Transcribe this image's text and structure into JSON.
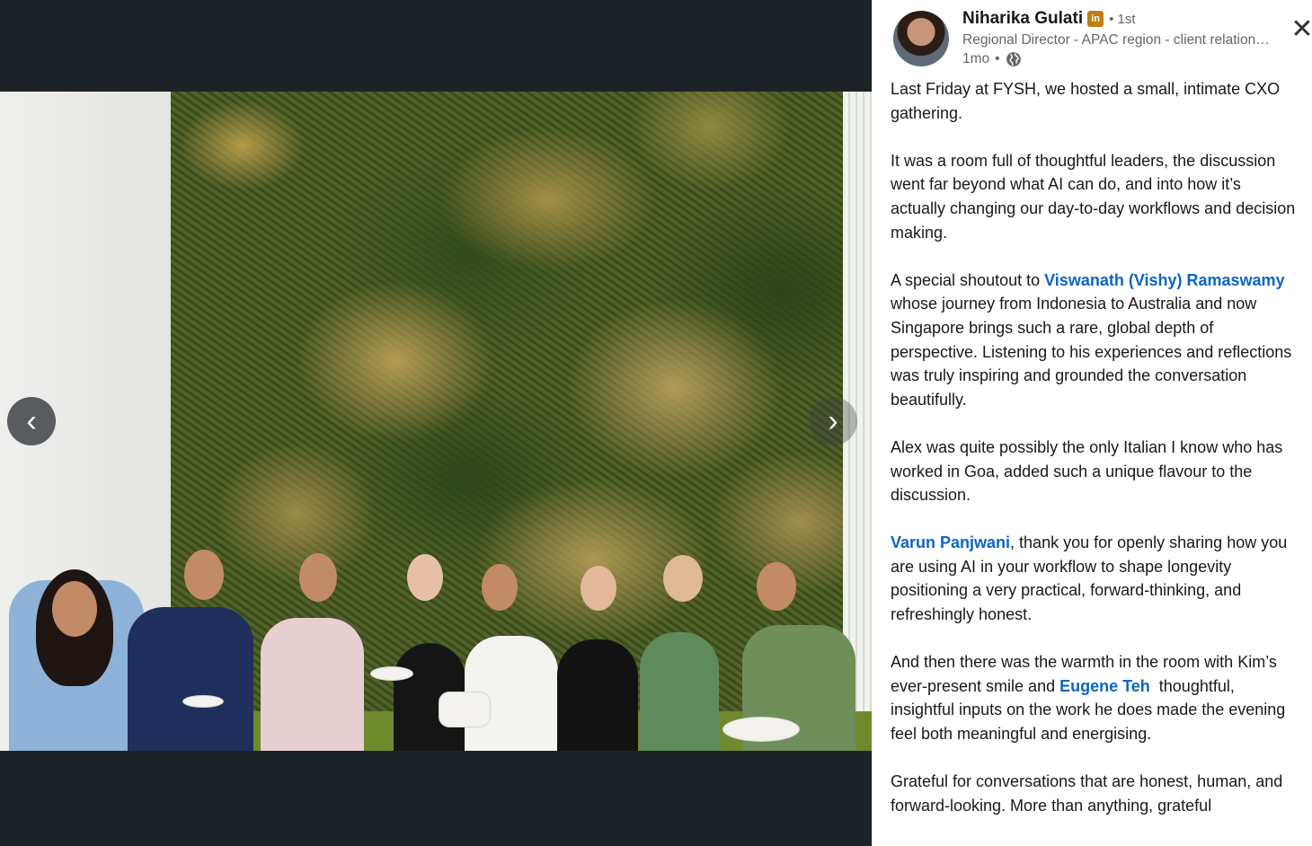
{
  "author": {
    "name": "Niharika Gulati",
    "badge": "in",
    "degree": "• 1st",
    "headline": "Regional Director - APAC region - client relationship leader",
    "time": "1mo",
    "visibility_separator": "•"
  },
  "controls": {
    "close": "✕",
    "prev": "‹",
    "next": "›"
  },
  "post": {
    "p1": "Last Friday at FYSH, we hosted a small, intimate CXO gathering.",
    "p2": "It was a room full of thoughtful leaders, the discussion went far beyond what AI can do, and into how it’s actually changing our day-to-day workflows and decision making.",
    "p3_before": "A special shoutout to ",
    "p3_mention": "Viswanath (Vishy) Ramaswamy",
    "p3_after": " whose journey from Indonesia to Australia and now Singapore brings such a rare, global depth of perspective. Listening to his experiences and reflections was truly inspiring and grounded the conversation beautifully.",
    "p4": "Alex was quite possibly the only Italian I know who has worked in Goa, added such a unique flavour to the discussion.",
    "p5_mention": "Varun Panjwani",
    "p5_after": ", thank you for openly sharing how you are using AI in your workflow to shape longevity positioning a very practical, forward-thinking, and refreshingly honest.",
    "p6_before": "And then there was the warmth in the room with Kim’s ever-present smile and ",
    "p6_mention": "Eugene Teh",
    "p6_after": "  thoughtful, insightful inputs on the work he does made the evening feel both meaningful and energising.",
    "p7": "Grateful for conversations that are honest, human, and forward-looking. More than anything, grateful"
  },
  "icons": {
    "badge": "linkedin-premium-icon",
    "globe": "globe-icon",
    "close": "close-icon",
    "prev": "chevron-left-icon",
    "next": "chevron-right-icon"
  },
  "colors": {
    "link": "#0a66c2",
    "badge": "#c37d16",
    "viewer_bg": "#1d2226"
  }
}
